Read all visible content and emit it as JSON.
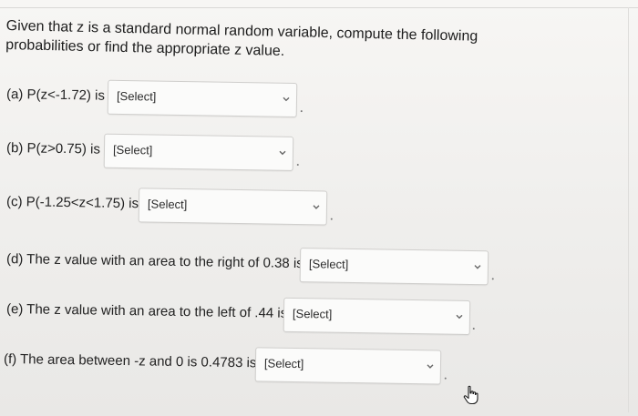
{
  "question": {
    "prompt": "Given that z is a standard normal random variable, compute the following probabilities or find the appropriate z value."
  },
  "items": [
    {
      "label": "(a) P(z<-1.72) is",
      "select_value": "[Select]"
    },
    {
      "label": "(b) P(z>0.75) is",
      "select_value": "[Select]"
    },
    {
      "label": "(c) P(-1.25<z<1.75) is",
      "select_value": "[Select]"
    },
    {
      "label": "(d) The z value with an area to the right of 0.38 is",
      "select_value": "[Select]"
    },
    {
      "label": "(e) The z value with an area to the left of .44 is",
      "select_value": "[Select]"
    },
    {
      "label": "(f) The area between -z and 0 is 0.4783 is",
      "select_value": "[Select]"
    }
  ],
  "icons": {
    "dropdown": "chevron-down-icon",
    "cursor": "hand-pointer-icon"
  }
}
